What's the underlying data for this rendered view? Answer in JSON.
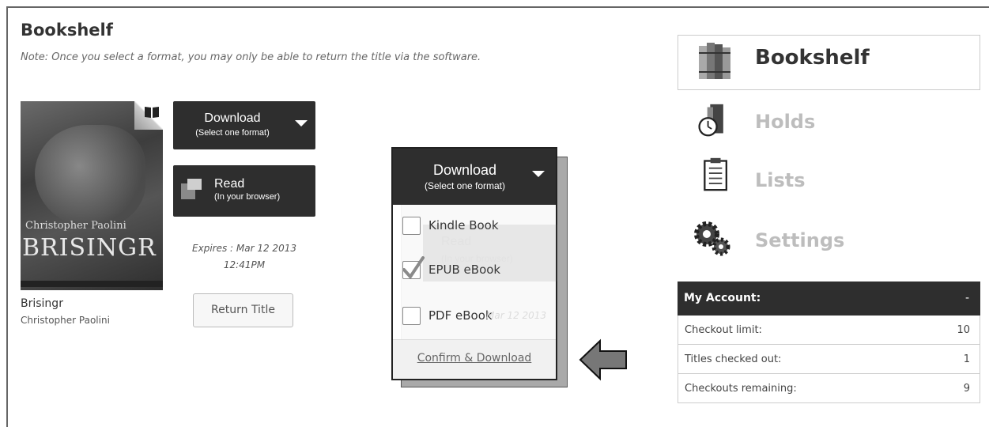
{
  "page": {
    "title": "Bookshelf",
    "note": "Note: Once you select a format, you may only be able to return the title via the software."
  },
  "book": {
    "cover_author": "Christopher Paolini",
    "cover_title": "BRISINGR",
    "title": "Brisingr",
    "author": "Christopher Paolini",
    "expires_line1": "Expires : Mar 12 2013",
    "expires_line2": "12:41PM",
    "return_label": "Return Title"
  },
  "download_button": {
    "label": "Download",
    "sublabel": "(Select one format)"
  },
  "read_button": {
    "label": "Read",
    "sublabel": "(In your browser)"
  },
  "popup": {
    "header_label": "Download",
    "header_sublabel": "(Select one format)",
    "options": [
      {
        "label": "Kindle Book",
        "checked": false
      },
      {
        "label": "EPUB eBook",
        "checked": true
      },
      {
        "label": "PDF eBook",
        "checked": false
      }
    ],
    "confirm_label": "Confirm & Download",
    "ghost_read": "Read",
    "ghost_read_sub": "(In your browser)",
    "ghost_expires": "Mar 12 2013"
  },
  "nav": {
    "items": [
      {
        "label": "Bookshelf",
        "icon": "books-icon",
        "active": true
      },
      {
        "label": "Holds",
        "icon": "stopwatch-icon",
        "active": false
      },
      {
        "label": "Lists",
        "icon": "clipboard-icon",
        "active": false
      },
      {
        "label": "Settings",
        "icon": "gears-icon",
        "active": false
      }
    ]
  },
  "account": {
    "title": "My Account:",
    "toggle": "-",
    "rows": [
      {
        "label": "Checkout limit:",
        "value": "10"
      },
      {
        "label": "Titles checked out:",
        "value": "1"
      },
      {
        "label": "Checkouts remaining:",
        "value": "9"
      }
    ]
  },
  "colors": {
    "dark": "#2e2e2e",
    "muted_nav": "#bdbdbd"
  }
}
